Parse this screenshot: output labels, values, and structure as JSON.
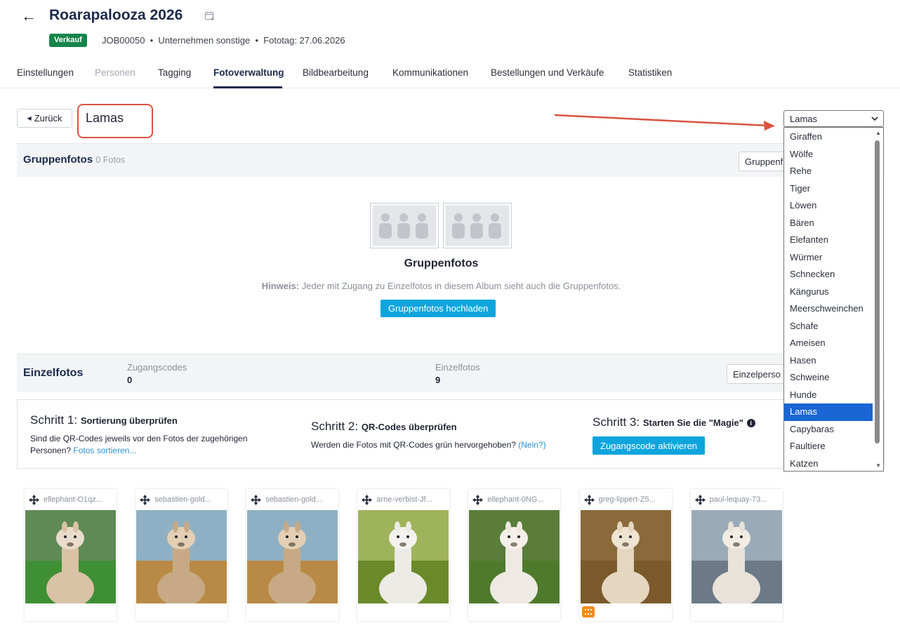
{
  "header": {
    "title": "Roarapalooza 2026",
    "badge": "Verkauf",
    "meta": "JOB00050  •  Unternehmen sonstige  •  Fototag: 27.06.2026"
  },
  "tabs": [
    {
      "label": "Einstellungen",
      "state": "normal"
    },
    {
      "label": "Personen",
      "state": "disabled"
    },
    {
      "label": "Tagging",
      "state": "normal"
    },
    {
      "label": "Fotoverwaltung",
      "state": "active"
    },
    {
      "label": "Bildbearbeitung",
      "state": "normal"
    },
    {
      "label": "Kommunikationen",
      "state": "normal"
    },
    {
      "label": "Bestellungen und Verkäufe",
      "state": "normal"
    },
    {
      "label": "Statistiken",
      "state": "normal"
    }
  ],
  "toolbar": {
    "back_label": "Zurück",
    "album_name": "Lamas"
  },
  "group_section": {
    "title": "Gruppenfotos",
    "count": "0 Fotos",
    "button_label": "Gruppenf",
    "empty_title": "Gruppenfotos",
    "hint_label": "Hinweis:",
    "hint_text": " Jeder mit Zugang zu Einzelfotos in diesem Album sieht auch die Gruppenfotos.",
    "upload_label": "Gruppenfotos hochladen"
  },
  "single_section": {
    "title": "Einzelfotos",
    "codes_label": "Zugangscodes",
    "codes_value": "0",
    "photos_label": "Einzelfotos",
    "photos_value": "9",
    "button_label": "Einzelperso"
  },
  "steps": {
    "step1_prefix": "Schritt 1: ",
    "step1_title": "Sortierung überprüfen",
    "step1_text": "Sind die QR-Codes jeweils vor den Fotos der zugehörigen Personen? ",
    "step1_link": "Fotos sortieren...",
    "step2_prefix": "Schritt 2: ",
    "step2_title": "QR-Codes überprüfen",
    "step2_text": "Werden die Fotos mit QR-Codes grün hervorgehoben? ",
    "step2_link": "(Nein?)",
    "step3_prefix": "Schritt 3: ",
    "step3_title": "Starten Sie die \"Magie\"",
    "step3_button": "Zugangscode aktivieren"
  },
  "photos": [
    {
      "name": "ellephant-O1qz..."
    },
    {
      "name": "sebastien-gold..."
    },
    {
      "name": "sebastien-gold..."
    },
    {
      "name": "arne-verbist-Jf..."
    },
    {
      "name": "ellephant-0NG..."
    },
    {
      "name": "greg-lippert-Z5..."
    },
    {
      "name": "paul-lequay-73..."
    }
  ],
  "album_select": {
    "selected": "Lamas",
    "options": [
      "Giraffen",
      "Wölfe",
      "Rehe",
      "Tiger",
      "Löwen",
      "Bären",
      "Elefanten",
      "Würmer",
      "Schnecken",
      "Kängurus",
      "Meerschweinchen",
      "Schafe",
      "Ameisen",
      "Hasen",
      "Schweine",
      "Hunde",
      "Lamas",
      "Capybaras",
      "Faultiere",
      "Katzen"
    ]
  },
  "colors": {
    "accent": "#0ea5dd",
    "badge": "#16854a",
    "highlight": "#d9533f",
    "selected_option": "#1a66d2",
    "qr_badge": "#f28c1b"
  }
}
